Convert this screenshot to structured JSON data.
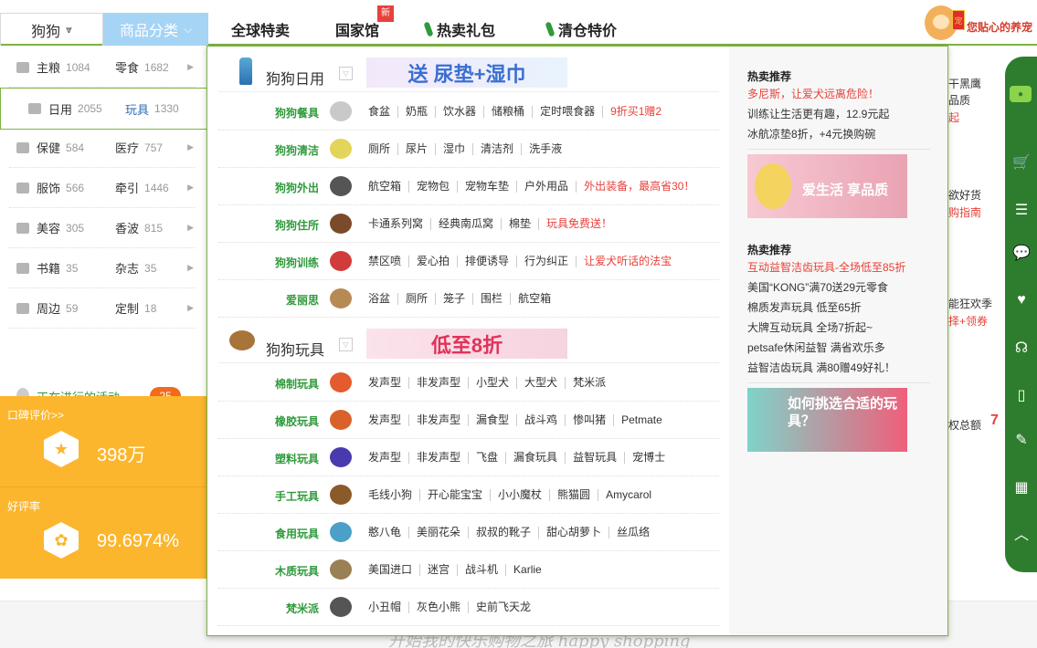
{
  "header": {
    "pet_select": "狗狗",
    "category_tab": "商品分类",
    "nav": [
      {
        "label": "全球特卖"
      },
      {
        "label": "国家馆",
        "badge": "新"
      },
      {
        "label": "热卖礼包"
      },
      {
        "label": "清仓特价"
      }
    ],
    "mascot_text": "您贴心的养宠",
    "mascot_tag": "宠"
  },
  "left_menu": {
    "rows": [
      {
        "a": "主粮",
        "a_count": "1084",
        "b": "零食",
        "b_count": "1682",
        "icon": "bone-icon"
      },
      {
        "a": "日用",
        "a_count": "2055",
        "b": "玩具",
        "b_count": "1330",
        "icon": "plane-icon"
      },
      {
        "a": "保健",
        "a_count": "584",
        "b": "医疗",
        "b_count": "757",
        "icon": "heart-icon"
      },
      {
        "a": "服饰",
        "a_count": "566",
        "b": "牵引",
        "b_count": "1446",
        "icon": "bowtie-icon"
      },
      {
        "a": "美容",
        "a_count": "305",
        "b": "香波",
        "b_count": "815",
        "icon": "building-icon"
      },
      {
        "a": "书籍",
        "a_count": "35",
        "b": "杂志",
        "b_count": "35",
        "icon": "book-icon"
      },
      {
        "a": "周边",
        "a_count": "59",
        "b": "定制",
        "b_count": "18",
        "icon": "location-icon"
      }
    ],
    "activity": "正在进行的活动",
    "activity_count": "25"
  },
  "scores": {
    "review_label": "口碑评价>>",
    "review_value": "398万",
    "rate_label": "好评率",
    "rate_value": "99.6974%"
  },
  "dropdown": {
    "section1": {
      "title": "狗狗日用",
      "banner": "送 尿垫+湿巾"
    },
    "rows1": [
      {
        "name": "狗狗餐具",
        "items": [
          "食盆",
          "奶瓶",
          "饮水器",
          "储粮桶",
          "定时喂食器"
        ],
        "promo": "9折买1赠2"
      },
      {
        "name": "狗狗清洁",
        "items": [
          "厕所",
          "尿片",
          "湿巾",
          "清洁剂",
          "洗手液"
        ],
        "promo": ""
      },
      {
        "name": "狗狗外出",
        "items": [
          "航空箱",
          "宠物包",
          "宠物车垫",
          "户外用品"
        ],
        "promo": "外出装备，最高省30！"
      },
      {
        "name": "狗狗住所",
        "items": [
          "卡通系列窝",
          "经典南瓜窝",
          "棉垫"
        ],
        "promo": "玩具免费送！"
      },
      {
        "name": "狗狗训练",
        "items": [
          "禁区喷",
          "爱心拍",
          "排便诱导",
          "行为纠正"
        ],
        "promo": "让爱犬听话的法宝"
      },
      {
        "name": "爱丽思",
        "items": [
          "浴盆",
          "厕所",
          "笼子",
          "围栏",
          "航空箱"
        ],
        "promo": ""
      }
    ],
    "section2": {
      "title": "狗狗玩具",
      "banner": "低至8折"
    },
    "rows2": [
      {
        "name": "棉制玩具",
        "items": [
          "发声型",
          "非发声型",
          "小型犬",
          "大型犬",
          "梵米派"
        ],
        "promo": ""
      },
      {
        "name": "橡胶玩具",
        "items": [
          "发声型",
          "非发声型",
          "漏食型",
          "战斗鸡",
          "惨叫猪",
          "Petmate"
        ],
        "promo": ""
      },
      {
        "name": "塑料玩具",
        "items": [
          "发声型",
          "非发声型",
          "飞盘",
          "漏食玩具",
          "益智玩具",
          "宠博士"
        ],
        "promo": ""
      },
      {
        "name": "手工玩具",
        "items": [
          "毛线小狗",
          "开心能宝宝",
          "小小魔杖",
          "熊猫圆",
          "Amycarol"
        ],
        "promo": ""
      },
      {
        "name": "食用玩具",
        "items": [
          "憨八龟",
          "美丽花朵",
          "叔叔的靴子",
          "甜心胡萝卜",
          "丝瓜络"
        ],
        "promo": ""
      },
      {
        "name": "木质玩具",
        "items": [
          "美国进口",
          "迷宫",
          "战斗机",
          "Karlie"
        ],
        "promo": ""
      },
      {
        "name": "梵米派",
        "items": [
          "小丑帽",
          "灰色小熊",
          "史前飞天龙"
        ],
        "promo": ""
      }
    ],
    "hot1": {
      "title": "热卖推荐",
      "lines": [
        "多尼斯，让爱犬远离危险！",
        "训练让生活更有趣，12.9元起",
        "冰航凉垫8折，+4元换购碗"
      ],
      "banner_text": "爱生活 享品质"
    },
    "hot2": {
      "title": "热卖推荐",
      "lines": [
        "互动益智洁齿玩具-全场低至85折",
        "美国“KONG”满70送29元零食",
        "棉质发声玩具 低至65折",
        "大牌互动玩具 全场7折起~",
        "petsafe休闲益智 满省欢乐多",
        "益智洁齿玩具 满80赠49好礼！"
      ],
      "banner_text": "如何挑选合适的玩具？"
    }
  },
  "background": {
    "t1": "干黑鹰",
    "t2": "品质",
    "t3": "起",
    "t4": "欲好货",
    "t5": "购指南",
    "t6": "能狂欢季",
    "t7": "择+领券",
    "t8": "权总额",
    "t9": "7",
    "footer_script": "开始我的快乐购物之旅 happy shopping"
  },
  "colors": {
    "green": "#2e9a3a",
    "orange": "#fcb62d",
    "red": "#e8413a",
    "blue_tab": "#a5d4f5"
  }
}
